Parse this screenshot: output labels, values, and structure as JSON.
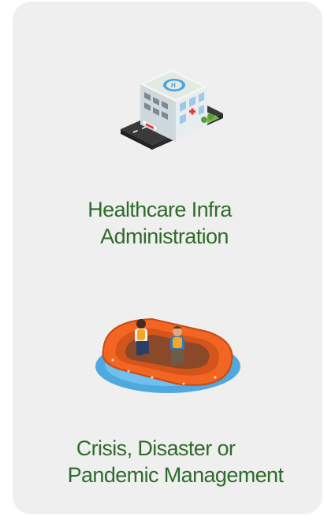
{
  "tiles": [
    {
      "icon": "hospital-building-icon",
      "line1": "Healthcare Infra",
      "line2": "Administration"
    },
    {
      "icon": "rescue-raft-icon",
      "line1": "Crisis, Disaster or",
      "line2": "Pandemic Management"
    }
  ],
  "colors": {
    "card_background": "#efefef",
    "label_text": "#2e6b2a"
  }
}
